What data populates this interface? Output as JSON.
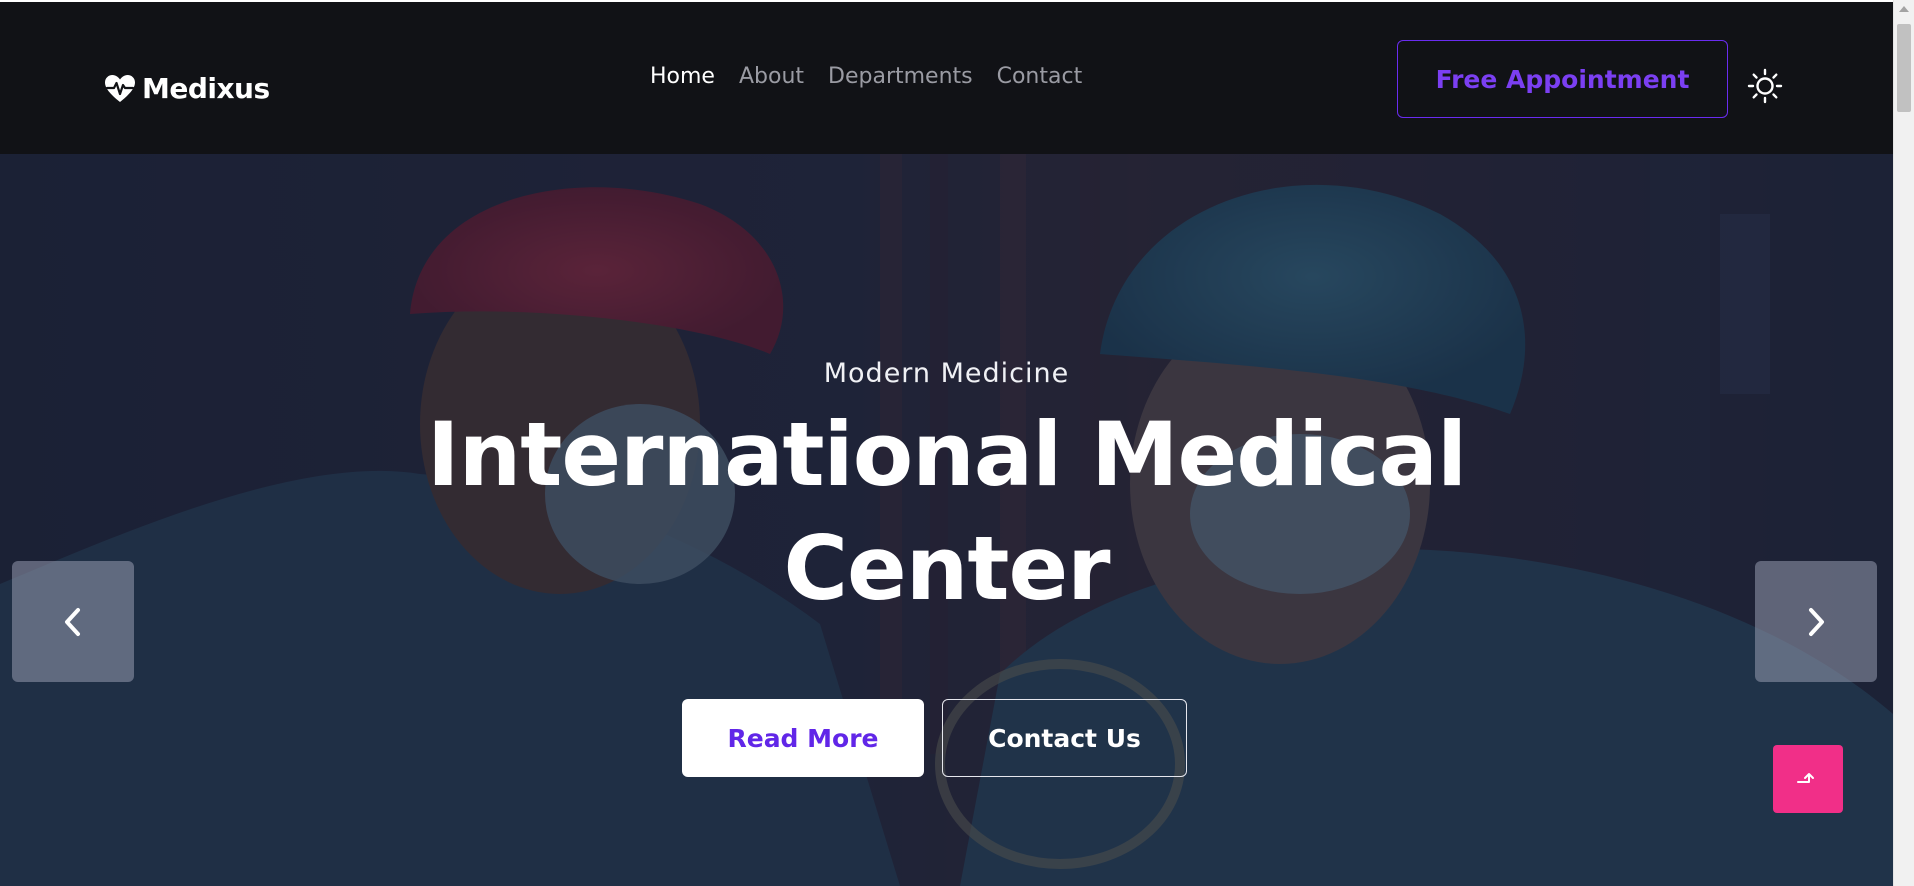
{
  "brand": {
    "name": "Medixus",
    "icon": "heart-pulse-icon"
  },
  "nav": {
    "links": [
      {
        "label": "Home",
        "active": true
      },
      {
        "label": "About",
        "active": false
      },
      {
        "label": "Departments",
        "active": false
      },
      {
        "label": "Contact",
        "active": false
      }
    ],
    "cta_label": "Free Appointment",
    "theme_icon": "sun-icon"
  },
  "hero": {
    "eyebrow": "Modern Medicine",
    "title_line1": "International Medical",
    "title_line2": "Center",
    "primary_button": "Read More",
    "secondary_button": "Contact Us",
    "prev_icon": "chevron-left-icon",
    "next_icon": "chevron-right-icon"
  },
  "back_to_top_icon": "arrow-up-return-icon",
  "colors": {
    "nav_bg": "#111216",
    "accent": "#6a2cf0",
    "pink": "#f12f88",
    "hero_overlay": "#1c2233"
  }
}
